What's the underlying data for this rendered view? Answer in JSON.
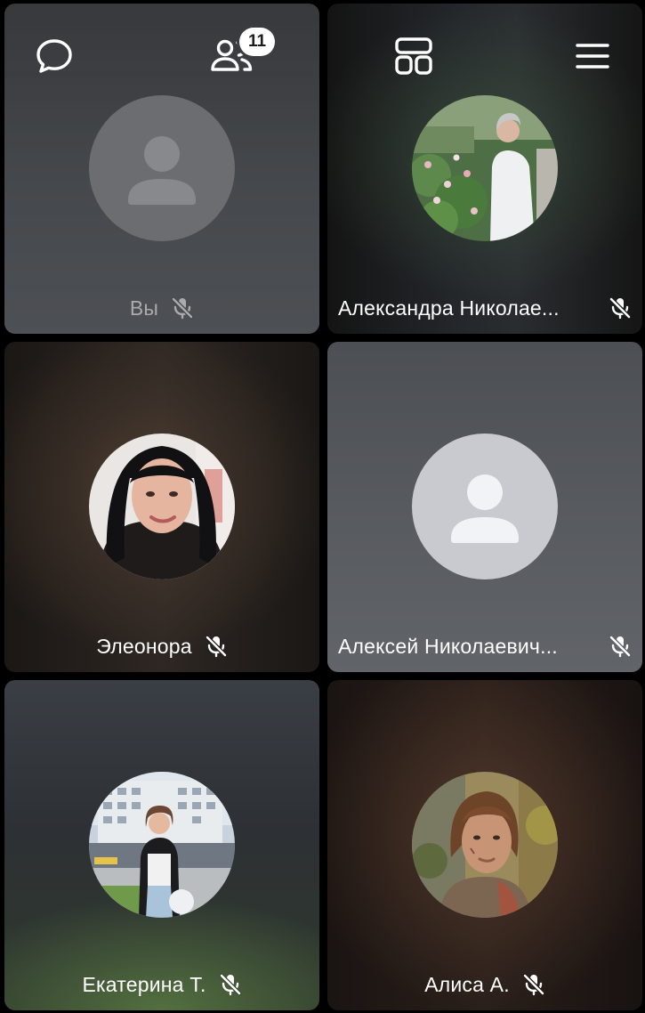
{
  "toolbar": {
    "chat_icon": "chat-bubble-icon",
    "participants_icon": "participants-icon",
    "participants_count": "11",
    "layout_icon": "grid-layout-icon",
    "menu_icon": "hamburger-menu-icon"
  },
  "participants": [
    {
      "name": "Вы",
      "avatar": "default",
      "muted": true
    },
    {
      "name": "Александра Николае...",
      "avatar": "photo",
      "muted": true
    },
    {
      "name": "Элеонора",
      "avatar": "photo",
      "muted": true
    },
    {
      "name": "Алексей Николаевич...",
      "avatar": "default",
      "muted": true
    },
    {
      "name": "Екатерина Т.",
      "avatar": "photo",
      "muted": true
    },
    {
      "name": "Алиса А.",
      "avatar": "photo",
      "muted": true
    }
  ],
  "colors": {
    "text": "#ffffff",
    "muted_text": "#a9abae",
    "badge_bg": "#ffffff",
    "badge_text": "#1d1d1f"
  }
}
